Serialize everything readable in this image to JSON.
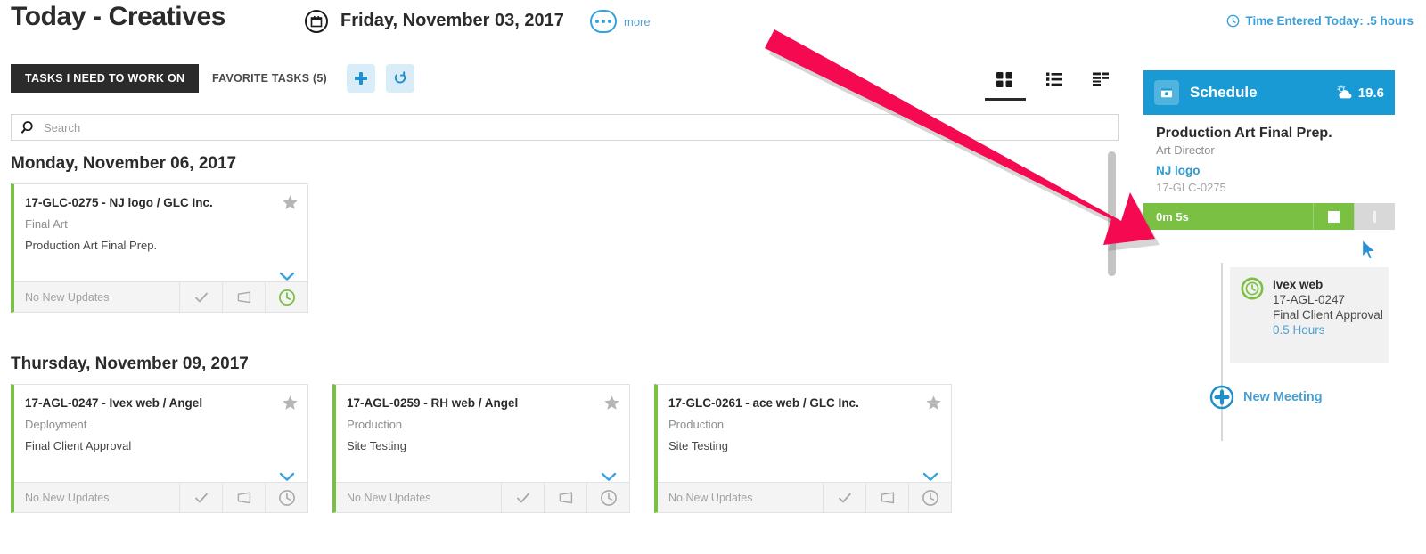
{
  "header": {
    "title": "Today - Creatives",
    "calendar_icon": "calendar-icon",
    "date": "Friday, November 03, 2017",
    "more_icon": "ellipsis-icon",
    "more_label": "more",
    "time_entered": "Time Entered Today: .5 hours",
    "time_icon": "clock-icon"
  },
  "tabs": {
    "active_label": "TASKS I NEED TO WORK ON",
    "favorite_label": "FAVORITE TASKS (5)",
    "add_icon": "plus-icon",
    "refresh_icon": "refresh-icon",
    "views": [
      {
        "name": "grid-view",
        "icon": "grid-icon",
        "active": true
      },
      {
        "name": "list-view",
        "icon": "list-icon",
        "active": false
      },
      {
        "name": "detail-view",
        "icon": "detail-list-icon",
        "active": false
      }
    ]
  },
  "search": {
    "placeholder": "Search",
    "value": "",
    "icon": "search-icon"
  },
  "days": [
    {
      "heading": "Monday, November 06, 2017",
      "cards": [
        {
          "title": "17-GLC-0275 - NJ logo / GLC Inc.",
          "phase": "Final Art",
          "task": "Production Art Final Prep.",
          "footer_text": "No New Updates",
          "star_icon": "star-icon",
          "chevron_icon": "chevron-down-icon",
          "actions": [
            "check-icon",
            "note-icon",
            "clock-icon"
          ],
          "timer_active": true
        }
      ]
    },
    {
      "heading": "Thursday, November 09, 2017",
      "cards": [
        {
          "title": "17-AGL-0247 - Ivex web / Angel",
          "phase": "Deployment",
          "task": "Final Client Approval",
          "footer_text": "No New Updates",
          "star_icon": "star-icon",
          "chevron_icon": "chevron-down-icon",
          "actions": [
            "check-icon",
            "note-icon",
            "clock-icon"
          ],
          "timer_active": false
        },
        {
          "title": "17-AGL-0259 - RH web / Angel",
          "phase": "Production",
          "task": "Site Testing",
          "footer_text": "No New Updates",
          "star_icon": "star-icon",
          "chevron_icon": "chevron-down-icon",
          "actions": [
            "check-icon",
            "note-icon",
            "clock-icon"
          ],
          "timer_active": false
        },
        {
          "title": "17-GLC-0261 - ace web / GLC Inc.",
          "phase": "Production",
          "task": "Site Testing",
          "footer_text": "No New Updates",
          "star_icon": "star-icon",
          "chevron_icon": "chevron-down-icon",
          "actions": [
            "check-icon",
            "note-icon",
            "clock-icon"
          ],
          "timer_active": false
        }
      ]
    }
  ],
  "panel": {
    "header": {
      "icon": "calendar-icon",
      "title": "Schedule",
      "weather_icon": "partly-cloudy-icon",
      "temperature": "19.6"
    },
    "active_task": {
      "title": "Production Art Final Prep.",
      "role": "Art Director",
      "project": "NJ logo",
      "code": "17-GLC-0275"
    },
    "timer": {
      "elapsed": "0m 5s",
      "stop_icon": "stop-icon",
      "pause_icon": "pause-icon"
    },
    "event": {
      "icon": "clock-circle-icon",
      "name": "Ivex web",
      "code": "17-AGL-0247",
      "task": "Final Client Approval",
      "hours": "0.5 Hours"
    },
    "new_meeting": {
      "icon": "plus-circle-icon",
      "label": "New Meeting"
    }
  },
  "annotation": {
    "arrow_color": "#F50A51",
    "arrow_icon": "pointer-arrow"
  },
  "colors": {
    "accent_blue": "#1a9ad4",
    "link_blue": "#2e9ad0",
    "green": "#7ac143",
    "dark": "#2b2b2b",
    "arrow_pink": "#F50A51"
  }
}
